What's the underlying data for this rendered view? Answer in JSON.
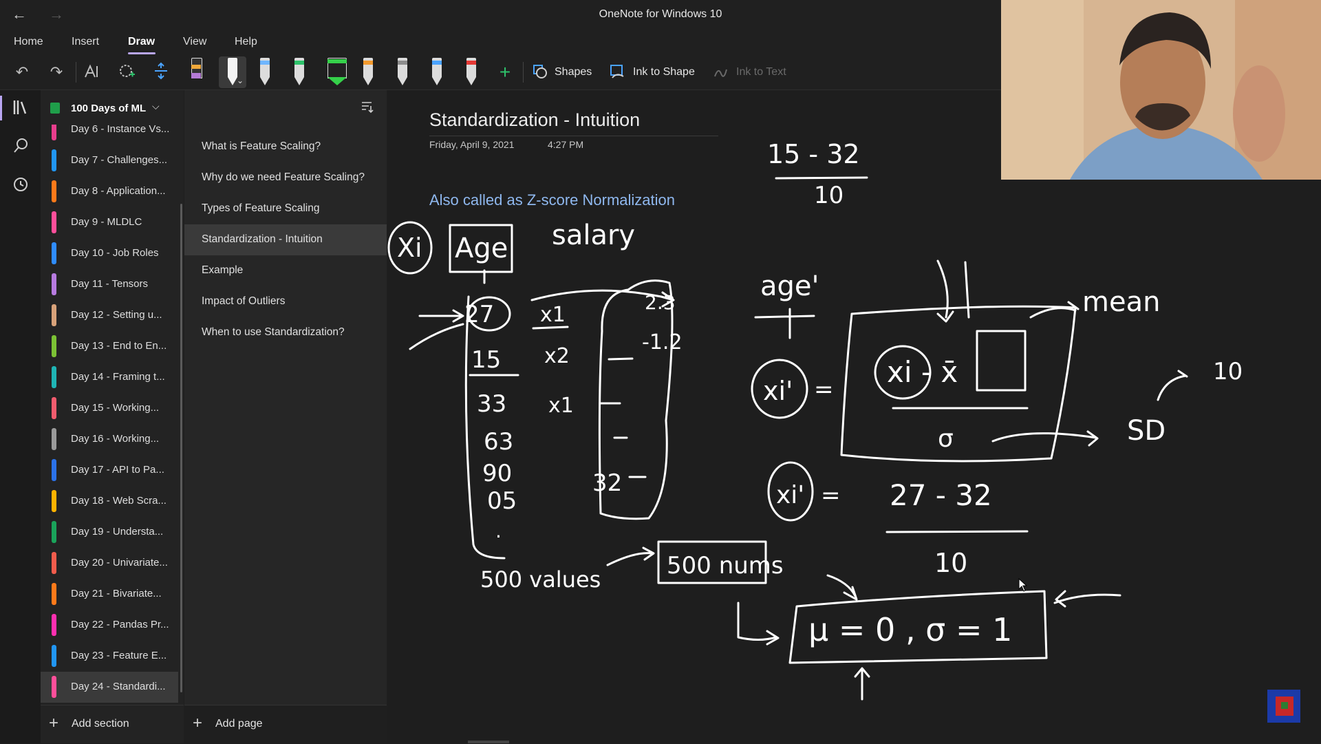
{
  "window": {
    "title": "OneNote for Windows 10",
    "back_icon": "arrow-left-icon",
    "forward_icon": "arrow-right-icon"
  },
  "menu": {
    "tabs": [
      "Home",
      "Insert",
      "Draw",
      "View",
      "Help"
    ],
    "active": "Draw"
  },
  "ribbon": {
    "tools": [
      "undo-icon",
      "redo-icon",
      "lasso-select-icon",
      "eraser-select-icon",
      "add-space-icon"
    ],
    "pens": [
      {
        "name": "highlighter-orange",
        "color": "#f2a93b"
      },
      {
        "name": "pen-black-selected",
        "color": "#ffffff"
      },
      {
        "name": "pen-light-blue",
        "color": "#6fb6ff"
      },
      {
        "name": "pen-green",
        "color": "#2ec26b"
      },
      {
        "name": "highlighter-green",
        "color": "#35d14a"
      },
      {
        "name": "pen-orange",
        "color": "#f29a2e"
      },
      {
        "name": "pen-gray",
        "color": "#bbbbbb"
      },
      {
        "name": "pen-blue",
        "color": "#4aa3ff"
      },
      {
        "name": "pen-red",
        "color": "#e53935"
      }
    ],
    "add_pen_icon": "plus-icon",
    "shapes_label": "Shapes",
    "ink_to_shape_label": "Ink to Shape",
    "ink_to_text_label": "Ink to Text"
  },
  "rail": {
    "icons": [
      "notebooks-icon",
      "search-icon",
      "recent-icon"
    ]
  },
  "notebook": {
    "name": "100 Days of ML",
    "sections": [
      {
        "label": "Day 6 - Instance Vs...",
        "color": "#e83e8c"
      },
      {
        "label": "Day 7 - Challenges...",
        "color": "#2196f3"
      },
      {
        "label": "Day 8 - Application...",
        "color": "#ff7a1a"
      },
      {
        "label": "Day 9 - MLDLC",
        "color": "#ff4f9a"
      },
      {
        "label": "Day 10 - Job Roles",
        "color": "#2f8cff"
      },
      {
        "label": "Day 11 - Tensors",
        "color": "#b77be0"
      },
      {
        "label": "Day 12 - Setting u...",
        "color": "#d8a27a"
      },
      {
        "label": "Day 13 - End to En...",
        "color": "#7cc234"
      },
      {
        "label": "Day 14 - Framing t...",
        "color": "#1fb5b5"
      },
      {
        "label": "Day 15 - Working...",
        "color": "#f25c6e"
      },
      {
        "label": "Day 16 - Working...",
        "color": "#9a9a9a"
      },
      {
        "label": "Day 17 - API to Pa...",
        "color": "#2b72e8"
      },
      {
        "label": "Day 18 - Web Scra...",
        "color": "#ffb300"
      },
      {
        "label": "Day 19 - Understa...",
        "color": "#1aa35a"
      },
      {
        "label": "Day 20 - Univariate...",
        "color": "#f25c4c"
      },
      {
        "label": "Day 21 - Bivariate...",
        "color": "#ff7a1a"
      },
      {
        "label": "Day 22 - Pandas Pr...",
        "color": "#ff2fb0"
      },
      {
        "label": "Day 23 - Feature E...",
        "color": "#2196f3"
      },
      {
        "label": "Day 24 - Standardi...",
        "color": "#ff4f9a"
      }
    ],
    "selected_section": "Day 24 - Standardi...",
    "add_section_label": "Add section"
  },
  "pages": {
    "sort_icon": "sort-icon",
    "items": [
      "What is Feature Scaling?",
      "Why do we need Feature Scaling?",
      "Types of Feature Scaling",
      "Standardization - Intuition",
      "Example",
      "Impact of Outliers",
      "When to use Standardization?"
    ],
    "selected": "Standardization - Intuition",
    "add_page_label": "Add page"
  },
  "note": {
    "title": "Standardization - Intuition",
    "date": "Friday, April 9, 2021",
    "time": "4:27 PM",
    "typed_text": "Also called as Z-score Normalization"
  },
  "ink_labels": {
    "fraction_top": "15 - 32",
    "fraction_bottom": "10",
    "col_header": "Xi",
    "age": "Age",
    "salary": "salary",
    "ages": [
      "27",
      "15",
      "33",
      "63",
      "90",
      "05"
    ],
    "x_labels": [
      "x1",
      "x2",
      "x1"
    ],
    "right_col": [
      "2.3",
      "-1.2"
    ],
    "mean_value": "32",
    "values_note": "500 values",
    "nums_box": "500 nums",
    "age_prime": "age'",
    "mean_word": "mean",
    "sd_word": "SD",
    "sd_value": "10",
    "formula_lhs": "xi'",
    "formula_num": "xi - x̄",
    "formula_den": "σ",
    "example_num": "27 - 32",
    "example_den": "10",
    "result": "μ = 0 , σ = 1"
  },
  "overlay": {
    "webcam_label": "presenter-webcam",
    "corner_logo": "channel-logo"
  }
}
